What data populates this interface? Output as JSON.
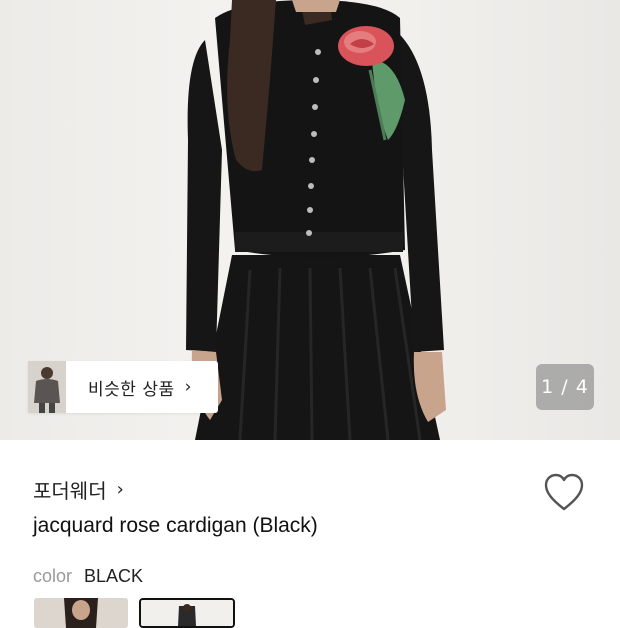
{
  "gallery": {
    "similar_products_label": "비슷한 상품",
    "similar_products_chevron": "›",
    "page_indicator": "1 / 4"
  },
  "product": {
    "brand": "포더웨더",
    "brand_chevron": "›",
    "title": "jacquard rose cardigan (Black)",
    "wishlist_icon": "heart-outline-icon"
  },
  "options": {
    "color_label": "color",
    "color_value": "BLACK",
    "swatches": [
      "swatch-1",
      "swatch-2-selected"
    ]
  },
  "colors": {
    "garment": "#141414",
    "rose": "#d9545a",
    "leaf": "#5f9a6a",
    "counter_bg": "#8a8a8a"
  }
}
